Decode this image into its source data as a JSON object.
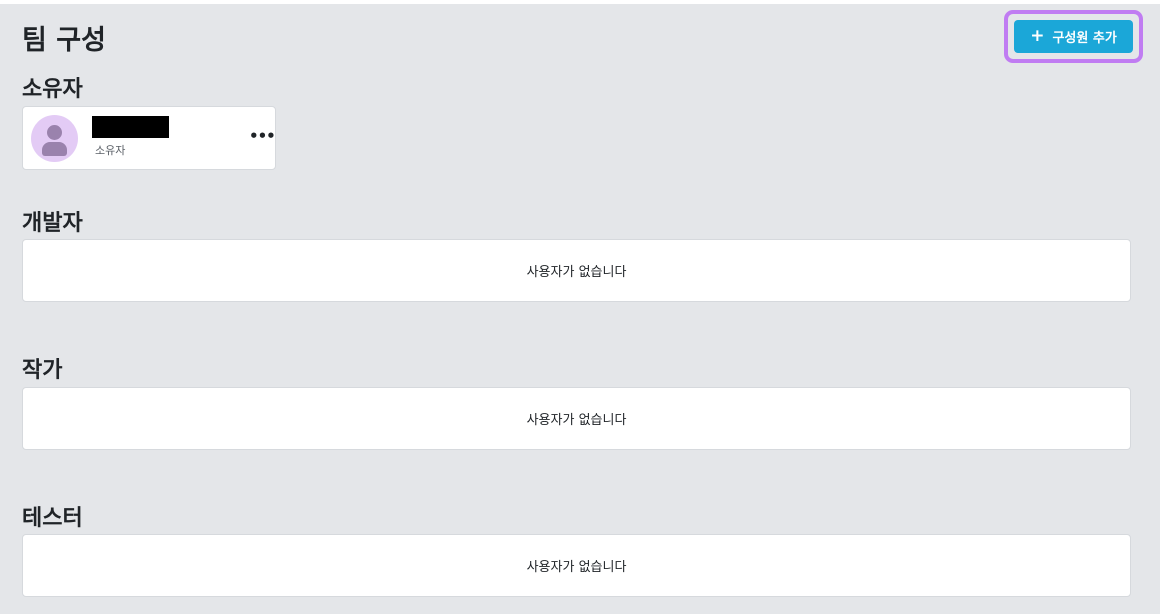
{
  "header": {
    "title": "팀 구성",
    "add_button_label": "구성원 추가",
    "add_button_icon": "+"
  },
  "sections": {
    "owner": {
      "title": "소유자",
      "member": {
        "name": "",
        "role": "소유자",
        "more_icon": "•••"
      }
    },
    "developer": {
      "title": "개발자",
      "empty_text": "사용자가 없습니다"
    },
    "writer": {
      "title": "작가",
      "empty_text": "사용자가 없습니다"
    },
    "tester": {
      "title": "테스터",
      "empty_text": "사용자가 없습니다"
    }
  },
  "colors": {
    "page_background": "#e4e6e9",
    "accent_button": "#1ba7d8",
    "highlight_border": "#c07cf2",
    "avatar_background": "#e3cbf5",
    "avatar_figure": "#9a82ad"
  }
}
